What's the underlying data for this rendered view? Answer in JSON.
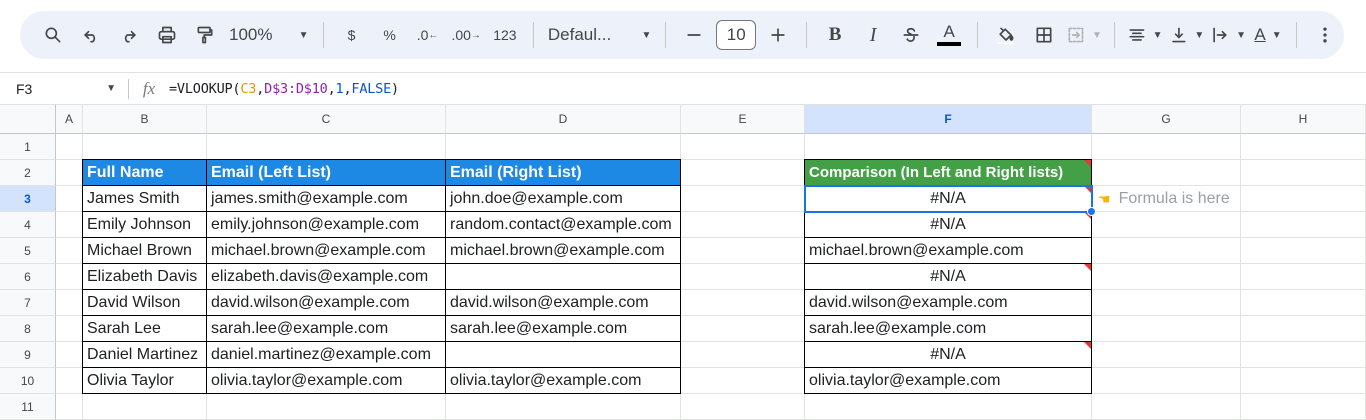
{
  "toolbar": {
    "zoom": "100%",
    "currency": "$",
    "percent": "%",
    "dec_decrease": ".0",
    "dec_increase": ".00",
    "number_format": "123",
    "font": "Defaul...",
    "font_size": "10",
    "bold": "B",
    "italic": "I",
    "text_color_letter": "A"
  },
  "formula_bar": {
    "cell_ref": "F3",
    "fx_label": "fx",
    "formula_parts": [
      {
        "text": "=VLOOKUP(",
        "cls": "f-fn"
      },
      {
        "text": "C3",
        "cls": "f-r1"
      },
      {
        "text": ",",
        "cls": "f-fn"
      },
      {
        "text": "D$3:D$10",
        "cls": "f-r2"
      },
      {
        "text": ",",
        "cls": "f-fn"
      },
      {
        "text": "1",
        "cls": "f-num"
      },
      {
        "text": ",",
        "cls": "f-fn"
      },
      {
        "text": "FALSE",
        "cls": "f-kw"
      },
      {
        "text": ")",
        "cls": "f-fn"
      }
    ]
  },
  "columns": [
    "A",
    "B",
    "C",
    "D",
    "E",
    "F",
    "G",
    "H"
  ],
  "rows": [
    "1",
    "2",
    "3",
    "4",
    "5",
    "6",
    "7",
    "8",
    "9",
    "10",
    "11"
  ],
  "selected": {
    "column": "F",
    "row": "3"
  },
  "left_table": {
    "headers": [
      "Full Name",
      "Email (Left List)",
      "Email (Right List)"
    ],
    "rows": [
      [
        "James Smith",
        "james.smith@example.com",
        "john.doe@example.com"
      ],
      [
        "Emily Johnson",
        "emily.johnson@example.com",
        "random.contact@example.com"
      ],
      [
        "Michael Brown",
        "michael.brown@example.com",
        "michael.brown@example.com"
      ],
      [
        "Elizabeth Davis",
        "elizabeth.davis@example.com",
        ""
      ],
      [
        "David Wilson",
        "david.wilson@example.com",
        "david.wilson@example.com"
      ],
      [
        "Sarah Lee",
        "sarah.lee@example.com",
        "sarah.lee@example.com"
      ],
      [
        "Daniel Martinez",
        "daniel.martinez@example.com",
        ""
      ],
      [
        "Olivia Taylor",
        "olivia.taylor@example.com",
        "olivia.taylor@example.com"
      ]
    ]
  },
  "comparison": {
    "header": "Comparison (In Left and Right lists)",
    "values": [
      {
        "text": "#N/A",
        "error": true
      },
      {
        "text": "#N/A",
        "error": true
      },
      {
        "text": "michael.brown@example.com",
        "error": false
      },
      {
        "text": "#N/A",
        "error": true
      },
      {
        "text": "david.wilson@example.com",
        "error": false
      },
      {
        "text": "sarah.lee@example.com",
        "error": false
      },
      {
        "text": "#N/A",
        "error": true
      },
      {
        "text": "olivia.taylor@example.com",
        "error": false
      }
    ]
  },
  "note": "Formula is here",
  "colors": {
    "header_blue": "#1e88e5",
    "header_green": "#43a047",
    "selection": "#1a73e8"
  }
}
